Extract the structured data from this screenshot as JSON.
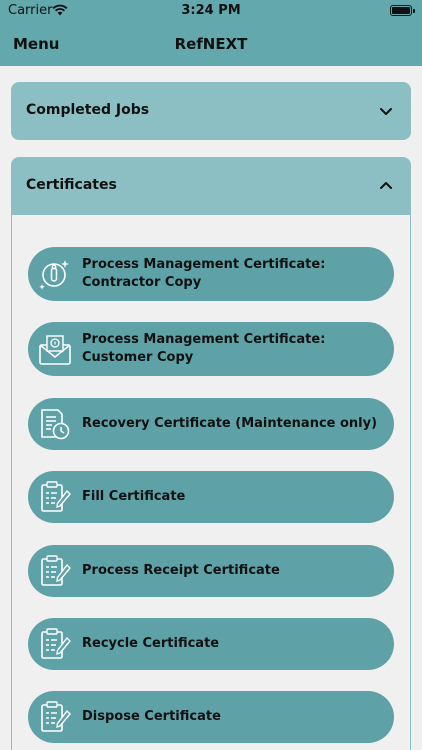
{
  "status_bar": {
    "carrier": "Carrier",
    "time": "3:24 PM"
  },
  "nav": {
    "menu_label": "Menu",
    "title": "RefNEXT"
  },
  "sections": {
    "completed_jobs": {
      "label": "Completed Jobs",
      "icon": "chevron-down-icon"
    },
    "certificates": {
      "label": "Certificates",
      "icon": "chevron-up-icon"
    }
  },
  "certificates": [
    {
      "label": "Process Management Certificate: Contractor Copy",
      "icon": "certificate-person-icon"
    },
    {
      "label": "Process Management Certificate: Customer Copy",
      "icon": "envelope-certificate-icon"
    },
    {
      "label": "Recovery Certificate (Maintenance only)",
      "icon": "document-clock-icon"
    },
    {
      "label": "Fill Certificate",
      "icon": "clipboard-pen-icon"
    },
    {
      "label": "Process Receipt Certificate",
      "icon": "clipboard-pen-icon"
    },
    {
      "label": "Recycle Certificate",
      "icon": "clipboard-pen-icon"
    },
    {
      "label": "Dispose Certificate",
      "icon": "clipboard-pen-icon"
    }
  ],
  "colors": {
    "primary": "#62a8ad",
    "section_header": "#8cbfc3",
    "button": "#5ea2a7",
    "background": "#f0f0f0"
  }
}
